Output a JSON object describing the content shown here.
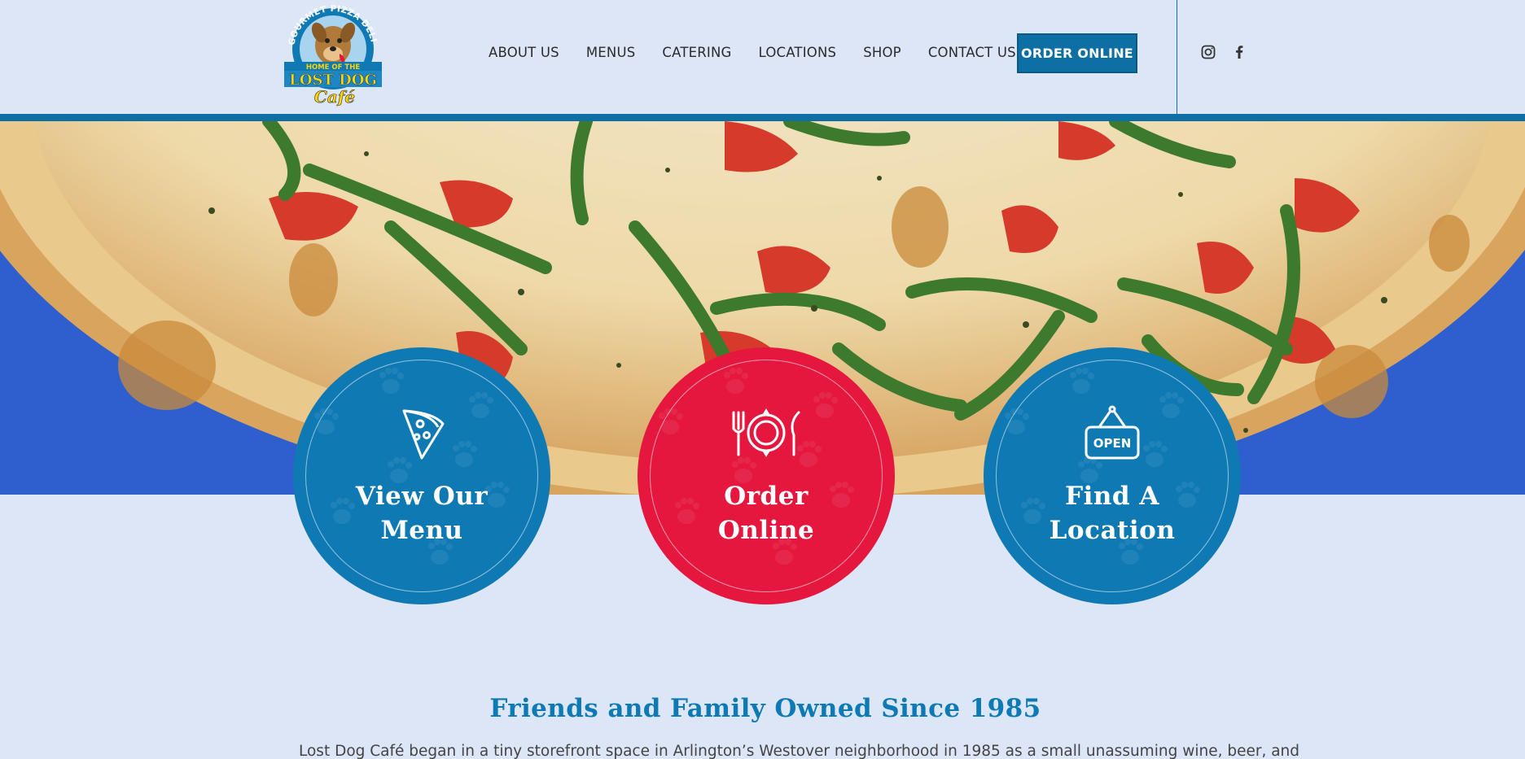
{
  "logo": {
    "top_text": "GOURMET PIZZA DELI",
    "band_text": "HOME OF THE",
    "name": "LOST DOG",
    "script": "Café"
  },
  "nav": {
    "items": [
      "ABOUT US",
      "MENUS",
      "CATERING",
      "LOCATIONS",
      "SHOP",
      "CONTACT US"
    ],
    "cta": "ORDER ONLINE"
  },
  "social": [
    "instagram-icon",
    "facebook-icon"
  ],
  "colors": {
    "brand_blue": "#0d6fa3",
    "circle_blue": "#0f79b3",
    "circle_red": "#e5173f",
    "page_bg": "#dce6f7",
    "heading_blue": "#0d7ab3"
  },
  "circles": [
    {
      "label": "View Our Menu",
      "icon": "pizza-slice-icon"
    },
    {
      "label": "Order Online",
      "icon": "plate-fork-knife-icon"
    },
    {
      "label": "Find A Location",
      "icon": "open-sign-icon",
      "sign_text": "OPEN"
    }
  ],
  "about": {
    "title": "Friends and Family Owned Since 1985",
    "text": "Lost Dog Café began in a tiny storefront space in Arlington’s Westover neighborhood in 1985 as a small unassuming wine, beer, and"
  }
}
